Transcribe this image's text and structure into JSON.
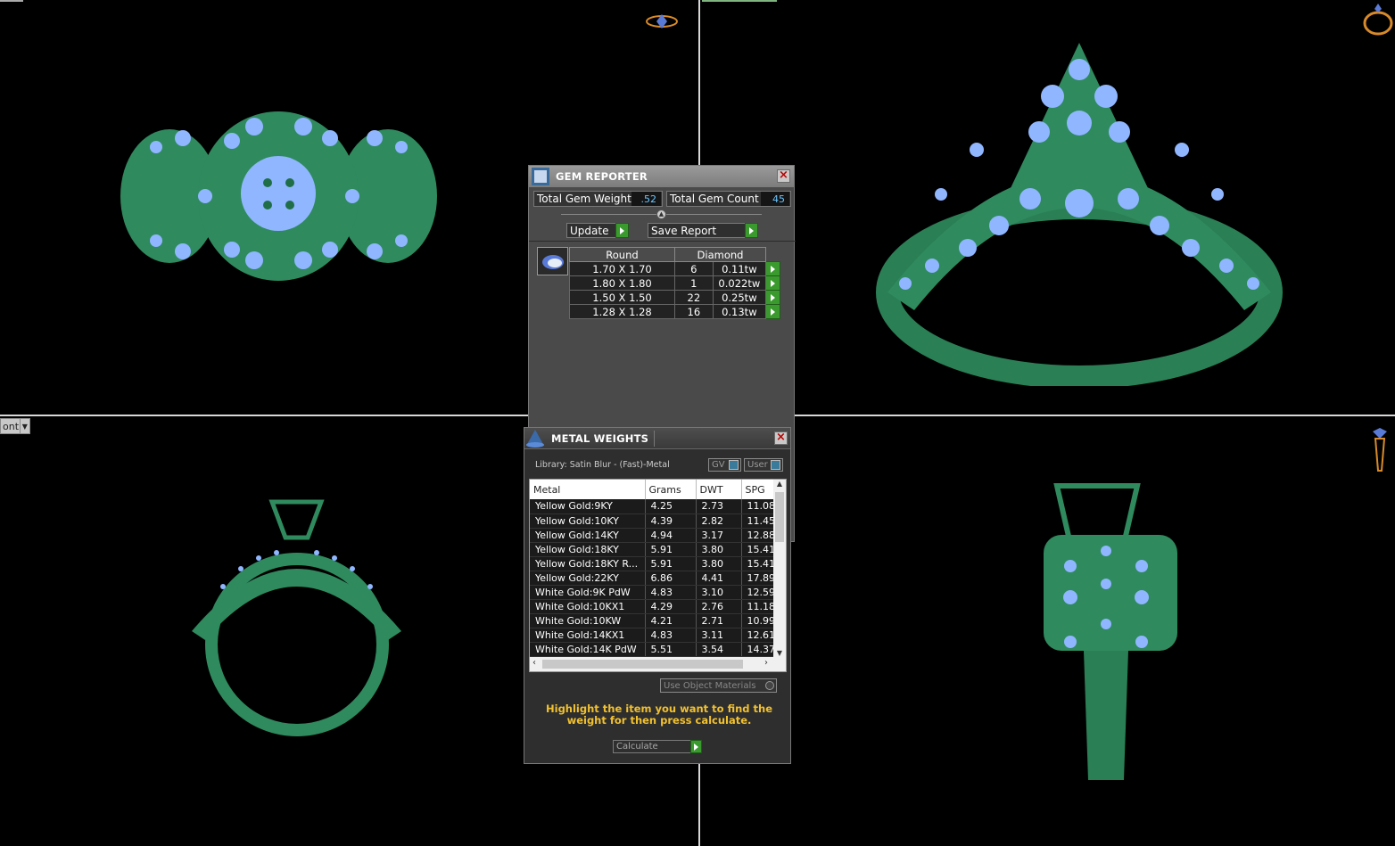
{
  "viewports": {
    "dropdown_label": "ont",
    "icons": [
      "ring-top-view-icon",
      "ring-perspective-icon",
      "ring-side-view-icon"
    ]
  },
  "gem_reporter": {
    "title": "GEM REPORTER",
    "total_weight_label": "Total Gem Weight",
    "total_weight_value": ".52",
    "total_count_label": "Total Gem Count",
    "total_count_value": "45",
    "update_label": "Update",
    "save_report_label": "Save Report",
    "table": {
      "headers": [
        "Round",
        "Diamond"
      ],
      "rows": [
        {
          "size": "1.70 X 1.70",
          "count": "6",
          "weight": "0.11tw"
        },
        {
          "size": "1.80 X 1.80",
          "count": "1",
          "weight": "0.022tw"
        },
        {
          "size": "1.50 X 1.50",
          "count": "22",
          "weight": "0.25tw"
        },
        {
          "size": "1.28 X 1.28",
          "count": "16",
          "weight": "0.13tw"
        }
      ]
    }
  },
  "metal_weights": {
    "title": "METAL WEIGHTS",
    "library": "Library: Satin Blur - (Fast)-Metal",
    "gv_label": "GV",
    "user_label": "User",
    "columns": [
      "Metal",
      "Grams",
      "DWT",
      "SPG"
    ],
    "rows": [
      {
        "metal": "Yellow Gold:9KY",
        "grams": "4.25",
        "dwt": "2.73",
        "spg": "11.08"
      },
      {
        "metal": "Yellow Gold:10KY",
        "grams": "4.39",
        "dwt": "2.82",
        "spg": "11.45"
      },
      {
        "metal": "Yellow Gold:14KY",
        "grams": "4.94",
        "dwt": "3.17",
        "spg": "12.88"
      },
      {
        "metal": "Yellow Gold:18KY",
        "grams": "5.91",
        "dwt": "3.80",
        "spg": "15.41"
      },
      {
        "metal": "Yellow Gold:18KY R...",
        "grams": "5.91",
        "dwt": "3.80",
        "spg": "15.41"
      },
      {
        "metal": "Yellow Gold:22KY",
        "grams": "6.86",
        "dwt": "4.41",
        "spg": "17.89"
      },
      {
        "metal": "White Gold:9K PdW",
        "grams": "4.83",
        "dwt": "3.10",
        "spg": "12.59"
      },
      {
        "metal": "White Gold:10KX1",
        "grams": "4.29",
        "dwt": "2.76",
        "spg": "11.18"
      },
      {
        "metal": "White Gold:10KW",
        "grams": "4.21",
        "dwt": "2.71",
        "spg": "10.99"
      },
      {
        "metal": "White Gold:14KX1",
        "grams": "4.83",
        "dwt": "3.11",
        "spg": "12.61"
      },
      {
        "metal": "White Gold:14K PdW",
        "grams": "5.51",
        "dwt": "3.54",
        "spg": "14.37"
      }
    ],
    "use_object_materials_label": "Use Object Materials",
    "instruction": "Highlight the item you want to find the weight for then press calculate.",
    "calculate_label": "Calculate"
  },
  "colors": {
    "metal_green": "#2f8a5e",
    "gem_blue": "#8fb6ff",
    "instruction_yellow": "#f2c12e",
    "go_green": "#3a9a2e"
  }
}
